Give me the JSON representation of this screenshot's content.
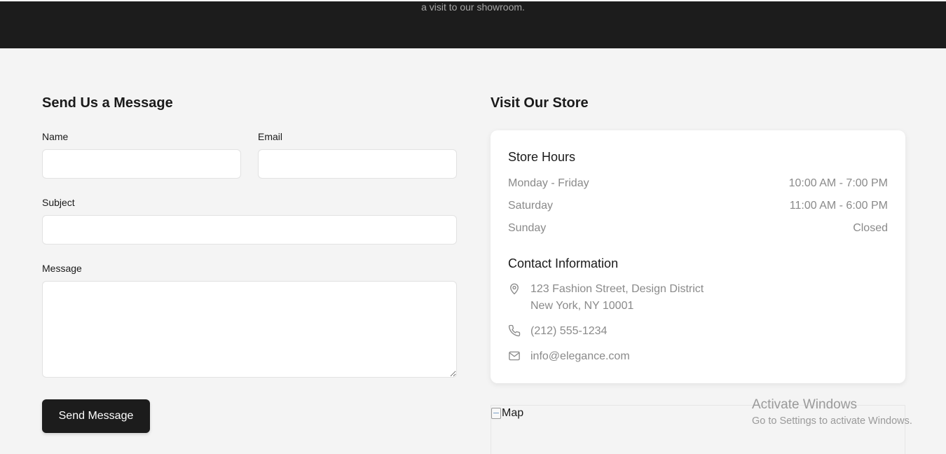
{
  "hero": {
    "subtitle": "a visit to our showroom."
  },
  "form": {
    "title": "Send Us a Message",
    "name_label": "Name",
    "name_value": "",
    "email_label": "Email",
    "email_value": "",
    "subject_label": "Subject",
    "subject_value": "",
    "message_label": "Message",
    "message_value": "",
    "submit_label": "Send Message"
  },
  "store": {
    "title": "Visit Our Store",
    "hours_title": "Store Hours",
    "hours": [
      {
        "day": "Monday - Friday",
        "time": "10:00 AM - 7:00 PM"
      },
      {
        "day": "Saturday",
        "time": "11:00 AM - 6:00 PM"
      },
      {
        "day": "Sunday",
        "time": "Closed"
      }
    ],
    "contact_title": "Contact Information",
    "address_line1": "123 Fashion Street, Design District",
    "address_line2": "New York, NY 10001",
    "phone": "(212) 555-1234",
    "email": "info@elegance.com",
    "address_icon": "map-pin-icon",
    "phone_icon": "phone-icon",
    "email_icon": "mail-icon",
    "map_alt": "Map"
  },
  "watermark": {
    "line1": "Activate Windows",
    "line2": "Go to Settings to activate Windows."
  },
  "colors": {
    "page_bg": "#f4f4f4",
    "hero_bg": "#1c1c1c",
    "button_bg": "#1c1c1c",
    "muted_text": "#8a8a8a"
  }
}
